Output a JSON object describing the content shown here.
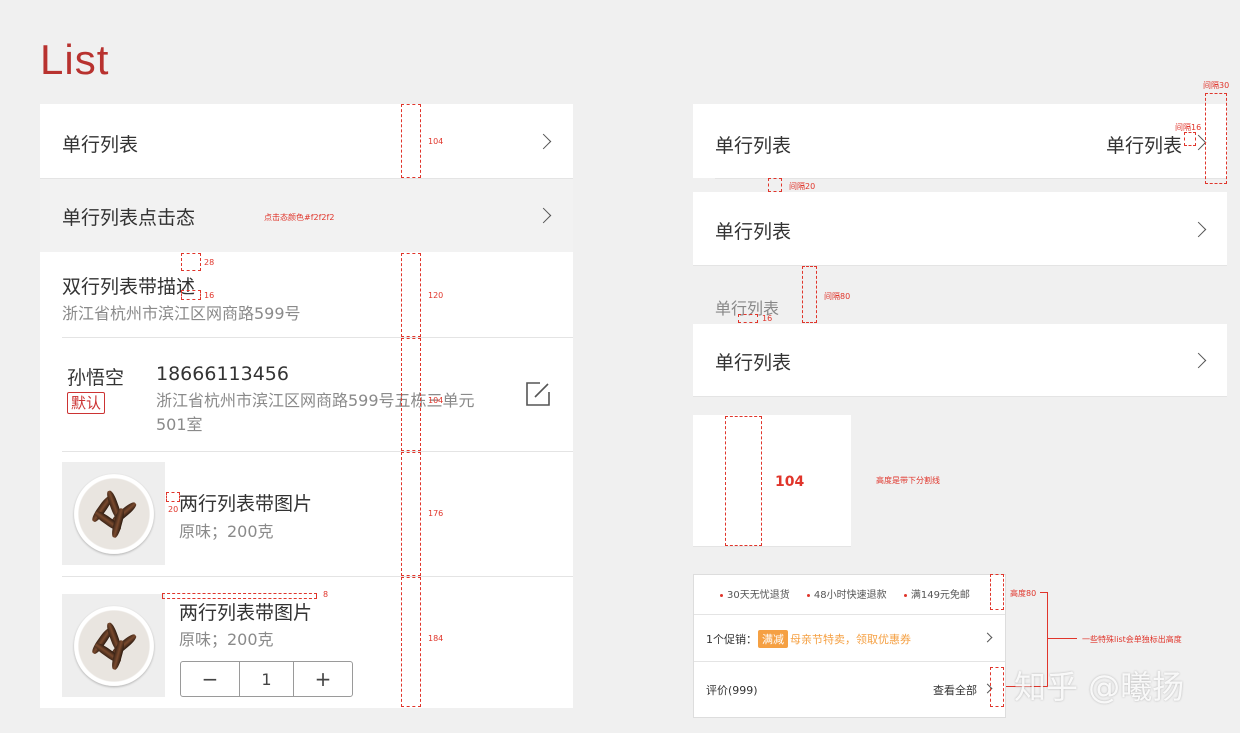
{
  "page_title": "List",
  "left": {
    "row1": {
      "label": "单行列表",
      "ann": "104"
    },
    "row2": {
      "label": "单行列表点击态",
      "ann": "点击态颜色#f2f2f2"
    },
    "row3": {
      "title": "双行列表带描述",
      "desc": "浙江省杭州市滨江区网商路599号",
      "ann_top": "28",
      "ann_gap": "16",
      "ann_h": "120"
    },
    "row4": {
      "name": "孙悟空",
      "badge": "默认",
      "phone": "18666113456",
      "address": "浙江省杭州市滨江区网商路599号五栋三单元501室",
      "ann": "104"
    },
    "row5": {
      "title": "两行列表带图片",
      "desc": "原味；200克",
      "ann_gap": "20",
      "ann_h": "176"
    },
    "row6": {
      "title": "两行列表带图片",
      "desc": "原味；200克",
      "ann_gap": "8",
      "ann_h": "184",
      "stepper": {
        "minus": "−",
        "value": "1",
        "plus": "+"
      }
    }
  },
  "right": {
    "row1": {
      "label": "单行列表",
      "value": "单行列表",
      "ann_gap30": "间隔30",
      "ann_gap16": "间隔16",
      "ann_gap20": "间隔20"
    },
    "row2": {
      "label": "单行列表"
    },
    "section_label": "单行列表",
    "section_ann_16": "16",
    "section_ann_80": "间隔80",
    "row3": {
      "label": "单行列表"
    },
    "height_demo": {
      "value": "104",
      "note": "高度是带下分割线"
    },
    "special": {
      "features": [
        "30天无忧退货",
        "48小时快速退款",
        "满149元免邮"
      ],
      "promo_label": "1个促销：",
      "promo_tag": "满减",
      "promo_text": "母亲节特卖，领取优惠券",
      "review_label": "评价(999)",
      "review_all": "查看全部",
      "ann_h80": "高度80",
      "ann_note": "一些特殊list会单独标出高度"
    }
  },
  "watermark": "知乎 @曦扬",
  "colors": {
    "accent": "#b8322f",
    "annotation": "#e0352b",
    "pressed": "#f2f2f2",
    "promo": "#f5a043"
  }
}
